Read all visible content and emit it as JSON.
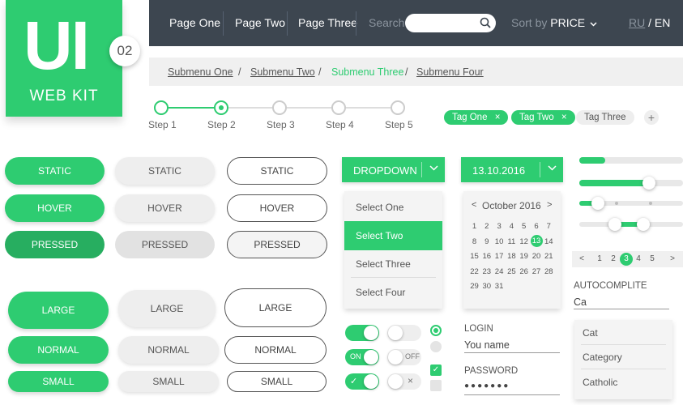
{
  "logo": {
    "main": "UI",
    "sub": "WEB KIT",
    "number": "02"
  },
  "nav": {
    "items": [
      "Page One",
      "Page Two",
      "Page Three"
    ],
    "search_placeholder": "Search",
    "sort_label": "Sort by",
    "sort_value": "PRICE",
    "lang_ru": "RU",
    "lang_sep": "/",
    "lang_en": "EN"
  },
  "breadcrumb": [
    "Submenu One",
    "Submenu Two",
    "Submenu Three",
    "Submenu Four"
  ],
  "breadcrumb_sep": "/",
  "steps": [
    "Step 1",
    "Step 2",
    "Step 3",
    "Step 4",
    "Step 5"
  ],
  "tags": {
    "one": "Tag One",
    "two": "Tag Two",
    "three": "Tag Three",
    "remove": "×",
    "add": "+"
  },
  "buttons": {
    "static": "STATIC",
    "hover": "HOVER",
    "pressed": "PRESSED",
    "large": "LARGE",
    "normal": "NORMAL",
    "small": "SMALL"
  },
  "dropdown": {
    "label": "DROPDOWN",
    "options": [
      "Select One",
      "Select Two",
      "Select Three",
      "Select Four"
    ]
  },
  "datepicker": {
    "value": "13.10.2016",
    "month": "October 2016",
    "prev": "<",
    "next": ">",
    "weeks": [
      [
        "1",
        "2",
        "3",
        "4",
        "5",
        "6",
        "7"
      ],
      [
        "8",
        "9",
        "10",
        "11",
        "12",
        "13",
        "14"
      ],
      [
        "15",
        "16",
        "17",
        "18",
        "19",
        "20",
        "21"
      ],
      [
        "22",
        "23",
        "24",
        "25",
        "26",
        "27",
        "28"
      ],
      [
        "29",
        "30",
        "31"
      ]
    ],
    "selected_day": "13"
  },
  "sliders": [
    0.22,
    0.72
  ],
  "range_slider": [
    0.2,
    0.62
  ],
  "pagination": {
    "prev": "<",
    "pages": [
      "1",
      "2",
      "3",
      "4",
      "5"
    ],
    "current": "3",
    "next": ">"
  },
  "toggles": {
    "on": "ON",
    "off": "OFF",
    "check": "✓",
    "cross": "×"
  },
  "login": {
    "login_label": "LOGIN",
    "login_value": "You name",
    "password_label": "PASSWORD",
    "password_value": "●●●●●●●"
  },
  "autocomplete": {
    "label": "AUTOCOMPLITE",
    "value": "Ca",
    "options": [
      "Cat",
      "Category",
      "Catholic"
    ]
  },
  "colors": {
    "accent": "#2ecc71",
    "accent_dark": "#27ae60",
    "nav_bg": "#3d4650"
  }
}
